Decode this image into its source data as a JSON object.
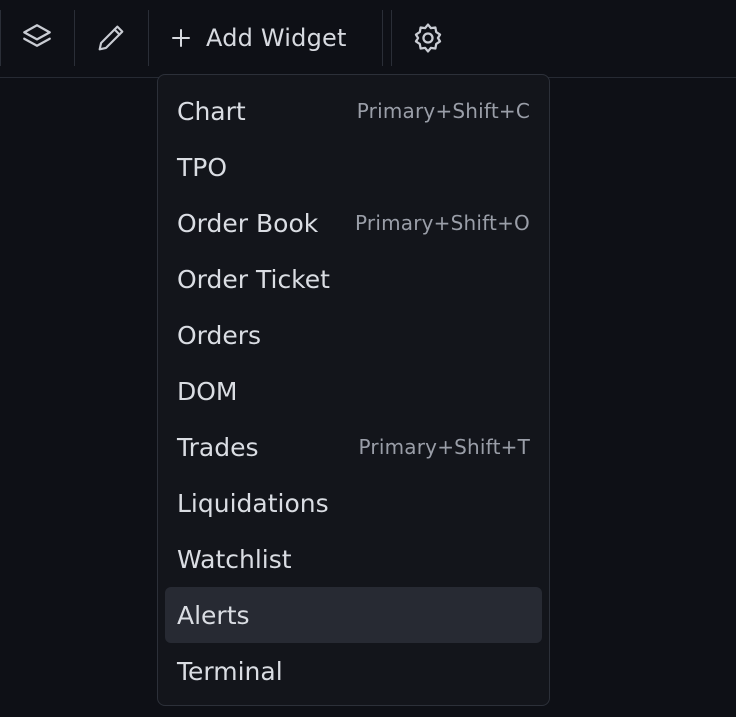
{
  "toolbar": {
    "layers_icon": "layers-icon",
    "edit_icon": "pencil-icon",
    "add_widget_label": "Add Widget",
    "settings_icon": "gear-icon"
  },
  "menu": {
    "active_index": 9,
    "items": [
      {
        "label": "Chart",
        "shortcut": "Primary+Shift+C"
      },
      {
        "label": "TPO",
        "shortcut": ""
      },
      {
        "label": "Order Book",
        "shortcut": "Primary+Shift+O"
      },
      {
        "label": "Order Ticket",
        "shortcut": ""
      },
      {
        "label": "Orders",
        "shortcut": ""
      },
      {
        "label": "DOM",
        "shortcut": ""
      },
      {
        "label": "Trades",
        "shortcut": "Primary+Shift+T"
      },
      {
        "label": "Liquidations",
        "shortcut": ""
      },
      {
        "label": "Watchlist",
        "shortcut": ""
      },
      {
        "label": "Alerts",
        "shortcut": ""
      },
      {
        "label": "Terminal",
        "shortcut": ""
      }
    ]
  },
  "colors": {
    "background": "#0e1016",
    "menu_background": "#13151b",
    "highlight": "#272a33",
    "text": "#dadde3",
    "shortcut_text": "#9a9ea8"
  }
}
